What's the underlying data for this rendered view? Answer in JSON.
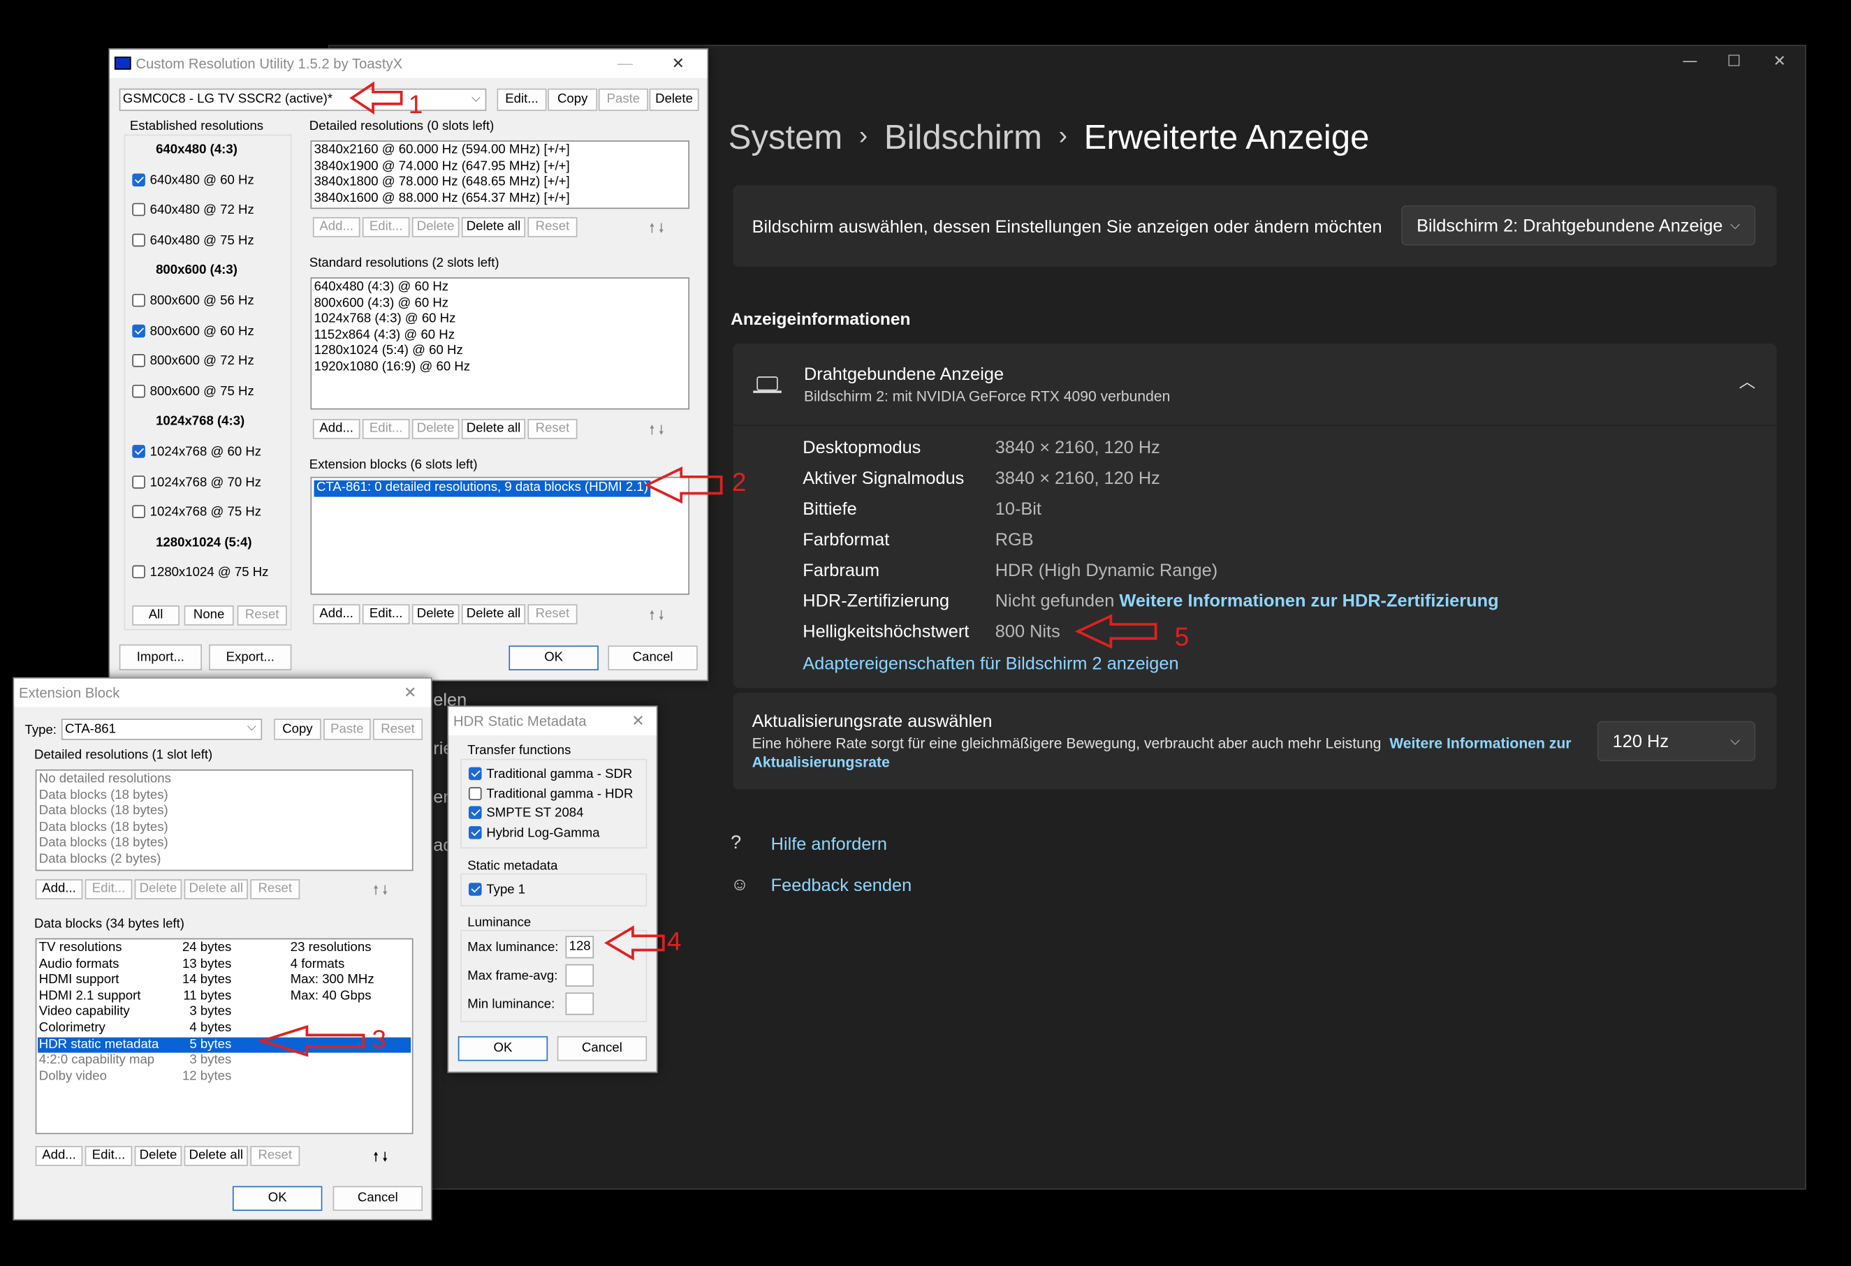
{
  "settings": {
    "breadcrumb": [
      "System",
      "Bildschirm",
      "Erweiterte Anzeige"
    ],
    "select_label": "Bildschirm auswählen, dessen Einstellungen Sie anzeigen oder ändern möchten",
    "select_value": "Bildschirm 2: Drahtgebundene Anzeige",
    "section_title": "Anzeigeinformationen",
    "display_name": "Drahtgebundene Anzeige",
    "display_sub": "Bildschirm 2: mit NVIDIA GeForce RTX 4090 verbunden",
    "info": [
      {
        "label": "Desktopmodus",
        "value": "3840 × 2160, 120 Hz"
      },
      {
        "label": "Aktiver Signalmodus",
        "value": "3840 × 2160, 120 Hz"
      },
      {
        "label": "Bittiefe",
        "value": "10-Bit"
      },
      {
        "label": "Farbformat",
        "value": "RGB"
      },
      {
        "label": "Farbraum",
        "value": "HDR (High Dynamic Range)"
      },
      {
        "label": "HDR-Zertifizierung",
        "value": "Nicht gefunden"
      },
      {
        "label": "Helligkeitshöchstwert",
        "value": "800 Nits"
      }
    ],
    "hdr_link": "Weitere Informationen zur HDR-Zertifizierung",
    "adapter_link": "Adaptereigenschaften für Bildschirm 2 anzeigen",
    "refresh_title": "Aktualisierungsrate auswählen",
    "refresh_desc": "Eine höhere Rate sorgt für eine gleichmäßigere Bewegung, verbraucht aber auch mehr Leistung",
    "refresh_link_1": "Weitere Informationen zur",
    "refresh_link_2": "Aktualisierungsrate",
    "refresh_value": "120 Hz",
    "help": "Hilfe anfordern",
    "feedback": "Feedback senden",
    "hidden_fragments": [
      "elen",
      "rie",
      "en",
      "ad"
    ]
  },
  "cru": {
    "title": "Custom Resolution Utility 1.5.2 by ToastyX",
    "monitor": "GSMC0C8 - LG TV SSCR2 (active)*",
    "top_buttons": [
      "Edit...",
      "Copy",
      "Paste",
      "Delete"
    ],
    "established_title": "Established resolutions",
    "established": [
      {
        "type": "h",
        "text": "640x480 (4:3)"
      },
      {
        "type": "c",
        "text": "640x480 @ 60 Hz",
        "checked": true
      },
      {
        "type": "c",
        "text": "640x480 @ 72 Hz",
        "checked": false
      },
      {
        "type": "c",
        "text": "640x480 @ 75 Hz",
        "checked": false
      },
      {
        "type": "h",
        "text": "800x600 (4:3)"
      },
      {
        "type": "c",
        "text": "800x600 @ 56 Hz",
        "checked": false
      },
      {
        "type": "c",
        "text": "800x600 @ 60 Hz",
        "checked": true
      },
      {
        "type": "c",
        "text": "800x600 @ 72 Hz",
        "checked": false
      },
      {
        "type": "c",
        "text": "800x600 @ 75 Hz",
        "checked": false
      },
      {
        "type": "h",
        "text": "1024x768 (4:3)"
      },
      {
        "type": "c",
        "text": "1024x768 @ 60 Hz",
        "checked": true
      },
      {
        "type": "c",
        "text": "1024x768 @ 70 Hz",
        "checked": false
      },
      {
        "type": "c",
        "text": "1024x768 @ 75 Hz",
        "checked": false
      },
      {
        "type": "h",
        "text": "1280x1024 (5:4)"
      },
      {
        "type": "c",
        "text": "1280x1024 @ 75 Hz",
        "checked": false
      }
    ],
    "est_buttons": [
      "All",
      "None",
      "Reset"
    ],
    "detailed_title": "Detailed resolutions (0 slots left)",
    "detailed": [
      "3840x2160 @ 60.000 Hz (594.00 MHz) [+/+]",
      "3840x1900 @ 74.000 Hz (647.95 MHz) [+/+]",
      "3840x1800 @ 78.000 Hz (648.65 MHz) [+/+]",
      "3840x1600 @ 88.000 Hz (654.37 MHz) [+/+]"
    ],
    "standard_title": "Standard resolutions (2 slots left)",
    "standard": [
      "640x480 (4:3) @ 60 Hz",
      "800x600 (4:3) @ 60 Hz",
      "1024x768 (4:3) @ 60 Hz",
      "1152x864 (4:3) @ 60 Hz",
      "1280x1024 (5:4) @ 60 Hz",
      "1920x1080 (16:9) @ 60 Hz"
    ],
    "extension_title": "Extension blocks (6 slots left)",
    "extension": [
      "CTA-861: 0 detailed resolutions, 9 data blocks (HDMI 2.1)"
    ],
    "list_buttons": [
      "Add...",
      "Edit...",
      "Delete",
      "Delete all",
      "Reset"
    ],
    "bottom_buttons": [
      "Import...",
      "Export...",
      "OK",
      "Cancel"
    ]
  },
  "ext": {
    "title": "Extension Block",
    "type_label": "Type:",
    "type_value": "CTA-861",
    "top_buttons": [
      "Copy",
      "Paste",
      "Reset"
    ],
    "detailed_title": "Detailed resolutions (1 slot left)",
    "detailed": [
      "No detailed resolutions",
      "Data blocks (18 bytes)",
      "Data blocks (18 bytes)",
      "Data blocks (18 bytes)",
      "Data blocks (18 bytes)",
      "Data blocks (2 bytes)"
    ],
    "data_title": "Data blocks (34 bytes left)",
    "data": [
      {
        "name": "TV resolutions",
        "bytes": "24 bytes",
        "info": "23 resolutions"
      },
      {
        "name": "Audio formats",
        "bytes": "13 bytes",
        "info": "4 formats"
      },
      {
        "name": "HDMI support",
        "bytes": "14 bytes",
        "info": "Max: 300 MHz"
      },
      {
        "name": "HDMI 2.1 support",
        "bytes": "11 bytes",
        "info": "Max: 40 Gbps"
      },
      {
        "name": "Video capability",
        "bytes": "3 bytes",
        "info": ""
      },
      {
        "name": "Colorimetry",
        "bytes": "4 bytes",
        "info": ""
      },
      {
        "name": "HDR static metadata",
        "bytes": "5 bytes",
        "info": ""
      },
      {
        "name": "4:2:0 capability map",
        "bytes": "3 bytes",
        "info": ""
      },
      {
        "name": "Dolby video",
        "bytes": "12 bytes",
        "info": ""
      }
    ],
    "list_buttons": [
      "Add...",
      "Edit...",
      "Delete",
      "Delete all",
      "Reset"
    ],
    "ok": "OK",
    "cancel": "Cancel"
  },
  "hdr": {
    "title": "HDR Static Metadata",
    "transfer_title": "Transfer functions",
    "transfer": [
      {
        "text": "Traditional gamma - SDR",
        "checked": true
      },
      {
        "text": "Traditional gamma - HDR",
        "checked": false
      },
      {
        "text": "SMPTE ST 2084",
        "checked": true
      },
      {
        "text": "Hybrid Log-Gamma",
        "checked": true
      }
    ],
    "static_title": "Static metadata",
    "static": [
      {
        "text": "Type 1",
        "checked": true
      }
    ],
    "lum_title": "Luminance",
    "max_lum_label": "Max luminance:",
    "max_lum_value": "128",
    "max_frame_label": "Max frame-avg:",
    "min_lum_label": "Min luminance:",
    "ok": "OK",
    "cancel": "Cancel"
  },
  "annotations": [
    "1",
    "2",
    "3",
    "4",
    "5"
  ]
}
